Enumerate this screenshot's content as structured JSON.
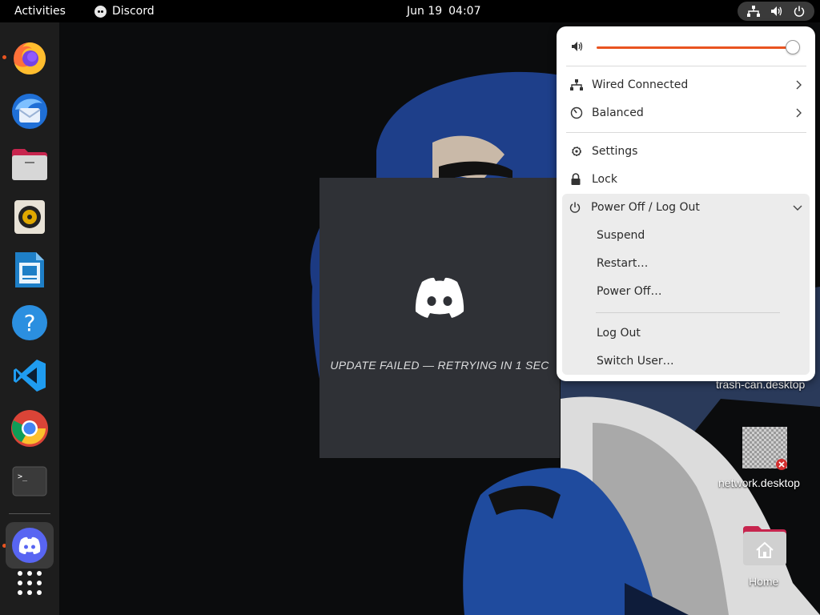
{
  "topbar": {
    "activities": "Activities",
    "app_name": "Discord",
    "date": "Jun 19",
    "time": "04:07"
  },
  "dock": {
    "items": [
      {
        "name": "firefox",
        "running": true
      },
      {
        "name": "thunderbird",
        "running": false
      },
      {
        "name": "files",
        "running": false
      },
      {
        "name": "rhythmbox",
        "running": false
      },
      {
        "name": "libreoffice-writer",
        "running": false
      },
      {
        "name": "help",
        "running": false
      },
      {
        "name": "vscode",
        "running": false
      },
      {
        "name": "chrome",
        "running": false
      },
      {
        "name": "terminal",
        "running": false
      },
      {
        "name": "discord",
        "running": true,
        "active": true
      },
      {
        "name": "show-apps",
        "running": false
      }
    ]
  },
  "splash": {
    "status": "UPDATE FAILED — RETRYING IN 1 SEC"
  },
  "desktop": {
    "trash_label": "trash-can.desktop",
    "network_label": "network.desktop",
    "home_label": "Home"
  },
  "quick_menu": {
    "volume_fraction": 0.98,
    "items": {
      "wired": "Wired Connected",
      "power_mode": "Balanced",
      "settings": "Settings",
      "lock": "Lock",
      "power_off_logout": "Power Off / Log Out",
      "suspend": "Suspend",
      "restart": "Restart…",
      "power_off": "Power Off…",
      "log_out": "Log Out",
      "switch_user": "Switch User…"
    }
  },
  "colors": {
    "accent": "#e95420",
    "discord_bg": "#2f3136",
    "topbar": "#000000",
    "dock": "#1d1d1d",
    "menu_bg": "#ffffff",
    "menu_section": "#ececec"
  }
}
